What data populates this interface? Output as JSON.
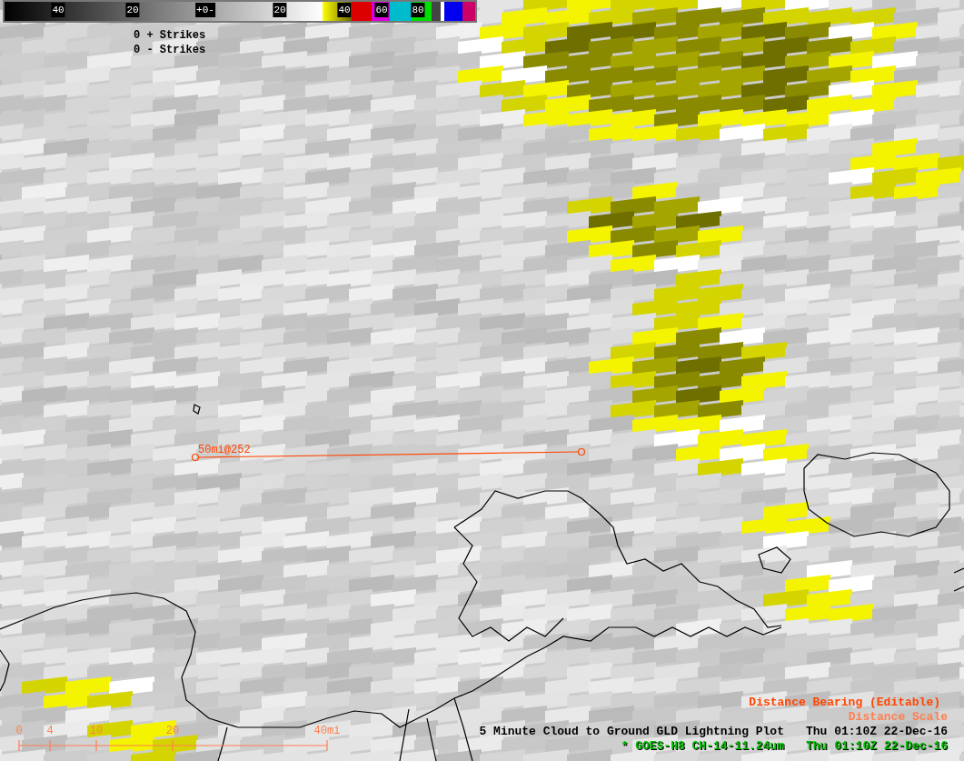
{
  "color_bar": {
    "labels": [
      "40",
      "20",
      "+0-",
      "20",
      "40",
      "60",
      "80"
    ]
  },
  "strikes": [
    "0 + Strikes",
    "0 - Strikes"
  ],
  "bearing": {
    "label": "50mi@252"
  },
  "distance_scale": {
    "labels": [
      "0",
      "4",
      "10",
      "20",
      "40mi"
    ]
  },
  "legend": [
    {
      "kind": "tool",
      "text": "Distance Bearing (Editable)"
    },
    {
      "kind": "scale",
      "text": "Distance Scale"
    },
    {
      "kind": "product",
      "text": "5 Minute Cloud to Ground GLD Lightning Plot",
      "time": "Thu 01:10Z 22-Dec-16"
    },
    {
      "kind": "satellite",
      "text": "* GOES-H8 CH-14-11.24um",
      "time": "Thu 01:10Z 22-Dec-16"
    }
  ]
}
